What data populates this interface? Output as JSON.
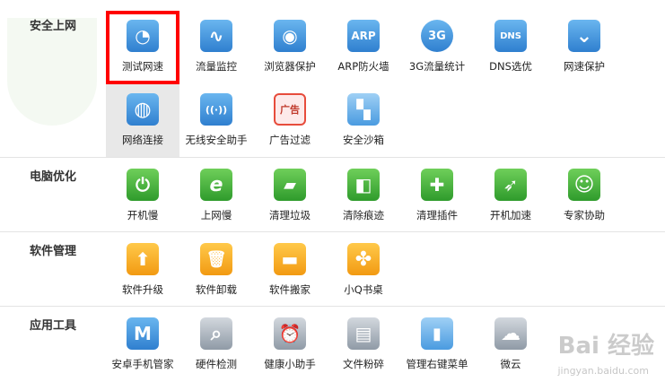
{
  "sections": [
    {
      "title": "安全上网",
      "tools": [
        {
          "label": "测试网速",
          "icon": "speedometer-icon",
          "glyph": "◔"
        },
        {
          "label": "流量监控",
          "icon": "traffic-chart-icon",
          "glyph": "∿"
        },
        {
          "label": "浏览器保护",
          "icon": "mouse-shield-icon",
          "glyph": "◉"
        },
        {
          "label": "ARP防火墙",
          "icon": "arp-icon",
          "glyph": "ARP"
        },
        {
          "label": "3G流量统计",
          "icon": "3g-icon",
          "glyph": "3G"
        },
        {
          "label": "DNS选优",
          "icon": "dns-icon",
          "glyph": "DNS"
        },
        {
          "label": "网速保护",
          "icon": "double-chevron-shield-icon",
          "glyph": "⌄"
        },
        {
          "label": "网络连接",
          "icon": "globe-icon",
          "glyph": "◍"
        },
        {
          "label": "无线安全助手",
          "icon": "wifi-shield-icon",
          "glyph": "((·))"
        },
        {
          "label": "广告过滤",
          "icon": "ad-block-icon",
          "glyph": "广告"
        },
        {
          "label": "安全沙箱",
          "icon": "sandbox-icon",
          "glyph": "▚"
        }
      ]
    },
    {
      "title": "电脑优化",
      "tools": [
        {
          "label": "开机慢",
          "icon": "power-icon",
          "glyph": "⏻"
        },
        {
          "label": "上网慢",
          "icon": "ie-icon",
          "glyph": "e"
        },
        {
          "label": "清理垃圾",
          "icon": "broom-icon",
          "glyph": "▰"
        },
        {
          "label": "清除痕迹",
          "icon": "eraser-icon",
          "glyph": "◧"
        },
        {
          "label": "清理插件",
          "icon": "puzzle-icon",
          "glyph": "✚"
        },
        {
          "label": "开机加速",
          "icon": "rocket-icon",
          "glyph": "➶"
        },
        {
          "label": "专家协助",
          "icon": "expert-icon",
          "glyph": "☺"
        }
      ]
    },
    {
      "title": "软件管理",
      "tools": [
        {
          "label": "软件升级",
          "icon": "upgrade-arrow-icon",
          "glyph": "⬆"
        },
        {
          "label": "软件卸载",
          "icon": "trash-icon",
          "glyph": "🗑"
        },
        {
          "label": "软件搬家",
          "icon": "truck-icon",
          "glyph": "▬"
        },
        {
          "label": "小Q书桌",
          "icon": "clover-icon",
          "glyph": "✤"
        }
      ]
    },
    {
      "title": "应用工具",
      "tools": [
        {
          "label": "安卓手机管家",
          "icon": "android-manager-icon",
          "glyph": "M"
        },
        {
          "label": "硬件检测",
          "icon": "magnifier-icon",
          "glyph": "⌕"
        },
        {
          "label": "健康小助手",
          "icon": "alarm-clock-icon",
          "glyph": "⏰"
        },
        {
          "label": "文件粉碎",
          "icon": "shredder-icon",
          "glyph": "▤"
        },
        {
          "label": "管理右键菜单",
          "icon": "mouse-icon",
          "glyph": "▮"
        },
        {
          "label": "微云",
          "icon": "cloud-icon",
          "glyph": "☁"
        }
      ]
    }
  ],
  "watermark": {
    "text": "Bai 经验",
    "sub": "jingyan.baidu.com"
  },
  "colors": {
    "highlight": "#ff0000",
    "selected_bg": "#e8e8e8",
    "blue": "#3a8fdc",
    "green": "#3ea83a",
    "orange": "#f5a623"
  }
}
